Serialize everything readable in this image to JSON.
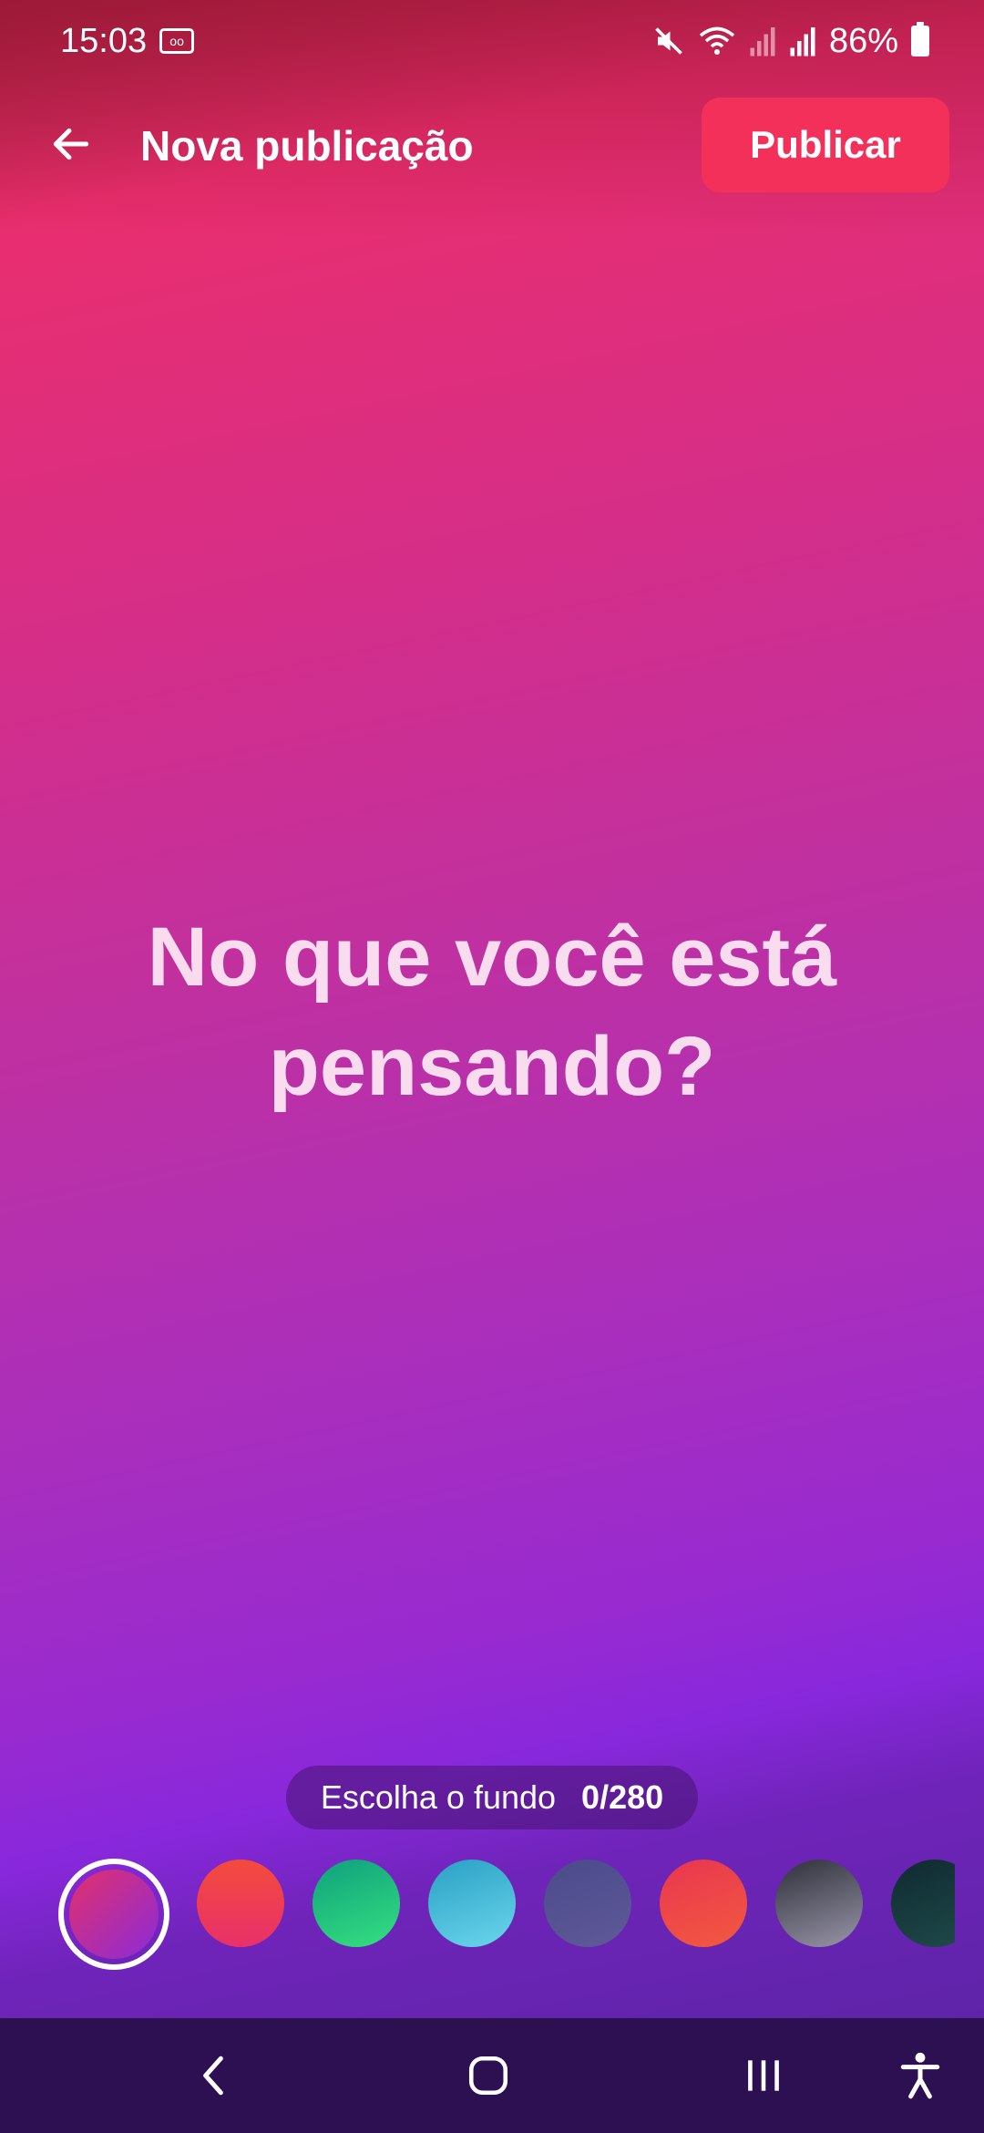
{
  "status_bar": {
    "time": "15:03",
    "battery": "86%",
    "icons": [
      "voicemail-icon",
      "mute-icon",
      "wifi-icon",
      "signal-icon",
      "signal-icon",
      "battery-icon"
    ]
  },
  "header": {
    "title": "Nova publicação",
    "publish_label": "Publicar",
    "publish_color": "#f3305a"
  },
  "composer": {
    "placeholder": "No que você está pensando?"
  },
  "background_picker": {
    "label": "Escolha o fundo",
    "char_count": "0/280",
    "swatches": [
      {
        "name": "pink-purple",
        "colors": [
          "#e3306b",
          "#8a2bd9"
        ],
        "selected": true
      },
      {
        "name": "coral-pink",
        "colors": [
          "#f44b3c",
          "#e8306a"
        ],
        "selected": false
      },
      {
        "name": "green",
        "colors": [
          "#0fa07e",
          "#35e07f"
        ],
        "selected": false
      },
      {
        "name": "cyan",
        "colors": [
          "#2aa0c4",
          "#6ad6ec"
        ],
        "selected": false
      },
      {
        "name": "slate-purple",
        "colors": [
          "#4b4a8a",
          "#5f5a9a"
        ],
        "selected": false
      },
      {
        "name": "red-orange",
        "colors": [
          "#e93650",
          "#f2593f"
        ],
        "selected": false
      },
      {
        "name": "dark-gray",
        "colors": [
          "#2f2f3a",
          "#9896a8"
        ],
        "selected": false
      },
      {
        "name": "dark-teal",
        "colors": [
          "#0f2a30",
          "#1f4a4a"
        ],
        "selected": false
      }
    ]
  },
  "nav_bar": {
    "icons": [
      "back-nav-icon",
      "home-nav-icon",
      "recents-nav-icon",
      "accessibility-icon"
    ]
  }
}
